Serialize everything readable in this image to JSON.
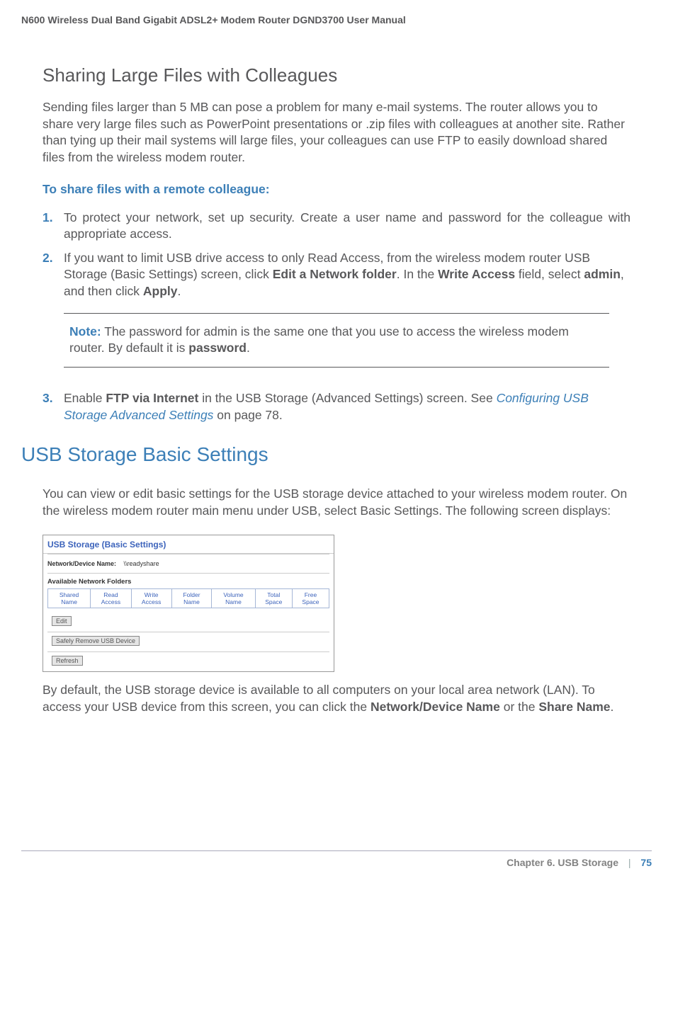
{
  "header": {
    "manual_title": "N600 Wireless Dual Band Gigabit ADSL2+ Modem Router DGND3700 User Manual"
  },
  "section1": {
    "heading": "Sharing Large Files with Colleagues",
    "intro": "Sending files larger than 5 MB can pose a problem for many e-mail systems. The router allows you to share very large files such as PowerPoint presentations or .zip files with colleagues at another site. Rather than tying up their mail systems will large files, your colleagues can use FTP to easily download shared files from the wireless modem router.",
    "subheading": "To share files with a remote colleague:",
    "step1_num": "1.",
    "step1": "To protect your network, set up security. Create a user name and password for the colleague with appropriate access.",
    "step2_num": "2.",
    "step2_a": "If you want to limit USB drive access to only Read Access, from the wireless modem router USB Storage (Basic Settings) screen, click ",
    "step2_b": "Edit a Network folder",
    "step2_c": ". In the ",
    "step2_d": "Write Access",
    "step2_e": " field, select ",
    "step2_f": "admin",
    "step2_g": ", and then click ",
    "step2_h": "Apply",
    "step2_i": ".",
    "note_label": "Note:",
    "note_text": "  The password for admin is the same one that you use to access the wireless modem router. By default it is ",
    "note_bold": "password",
    "note_end": ".",
    "step3_num": "3.",
    "step3_a": "Enable ",
    "step3_b": "FTP via Internet",
    "step3_c": " in the USB Storage (Advanced Settings) screen. See ",
    "step3_link": "Configuring USB Storage Advanced Settings",
    "step3_d": " on page 78."
  },
  "section2": {
    "heading": "USB Storage Basic Settings",
    "intro": "You can view or edit basic settings for the USB storage device attached to your wireless modem router. On the wireless modem router main menu under USB, select Basic Settings. The following screen displays:",
    "after_shot_a": "By default, the USB storage device is available to all computers on your local area network (LAN). To access your USB device from this screen, you can click the ",
    "after_shot_b": "Network/Device Name",
    "after_shot_c": " or the ",
    "after_shot_d": "Share Name",
    "after_shot_e": "."
  },
  "screenshot": {
    "title": "USB Storage (Basic Settings)",
    "netname_label": "Network/Device Name:",
    "netname_value": " \\\\readyshare",
    "avail_label": "Available Network Folders",
    "cols": {
      "shared": "Shared Name",
      "read": "Read Access",
      "write": "Write Access",
      "folder": "Folder Name",
      "volume": "Volume Name",
      "total": "Total Space",
      "free": "Free Space"
    },
    "edit_btn": "Edit",
    "safely_btn": "Safely Remove USB Device",
    "refresh_btn": "Refresh"
  },
  "footer": {
    "chapter": "Chapter 6.  USB Storage",
    "bar": "|",
    "page": "75"
  }
}
